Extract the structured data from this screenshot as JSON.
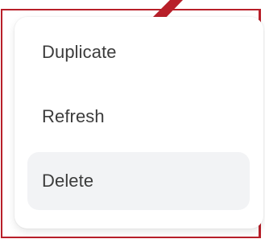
{
  "menu": {
    "items": [
      {
        "label": "Duplicate",
        "state": "default"
      },
      {
        "label": "Refresh",
        "state": "default"
      },
      {
        "label": "Delete",
        "state": "hovered"
      }
    ],
    "hover_background": "#f2f3f5",
    "text_color": "#3c3c3c"
  },
  "annotation": {
    "color": "#b81f29"
  }
}
